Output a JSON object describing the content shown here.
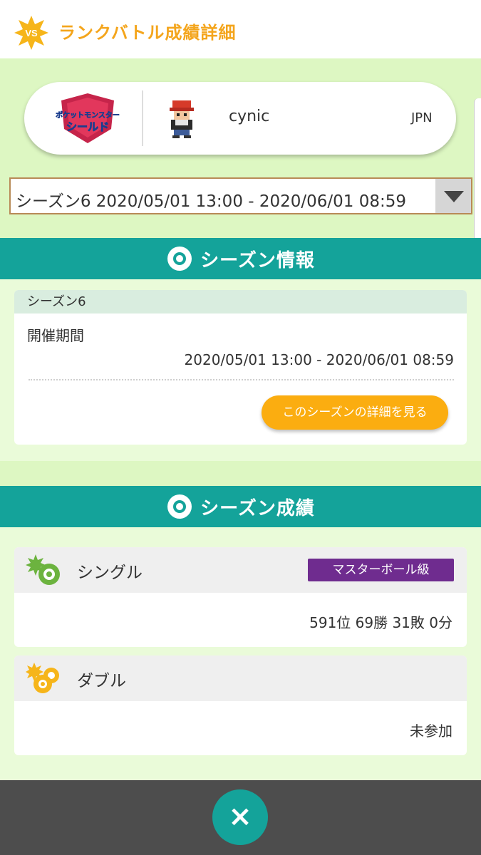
{
  "header": {
    "badge": "VS",
    "title": "ランクバトル成績詳細"
  },
  "profile": {
    "game_logo_text_top": "ポケットモンスター",
    "game_logo_text_bottom": "シールド",
    "player_name": "cynic",
    "country": "JPN"
  },
  "season_select": {
    "selected": "シーズン6 2020/05/01 13:00 - 2020/06/01 08:59"
  },
  "season_info": {
    "section_title": "シーズン情報",
    "season_name": "シーズン6",
    "period_label": "開催期間",
    "period_value": "2020/05/01 13:00 - 2020/06/01 08:59",
    "detail_button": "このシーズンの詳細を見る"
  },
  "season_results": {
    "section_title": "シーズン成績",
    "single": {
      "label": "シングル",
      "rank_badge": "マスターボール級",
      "record": "591位 69勝 31敗 0分"
    },
    "double": {
      "label": "ダブル",
      "record": "未参加"
    }
  },
  "close_button": "×",
  "colors": {
    "accent_teal": "#14a39a",
    "header_orange": "#f4a51c",
    "button_orange": "#fbad10",
    "master_purple": "#6f2c8f"
  }
}
